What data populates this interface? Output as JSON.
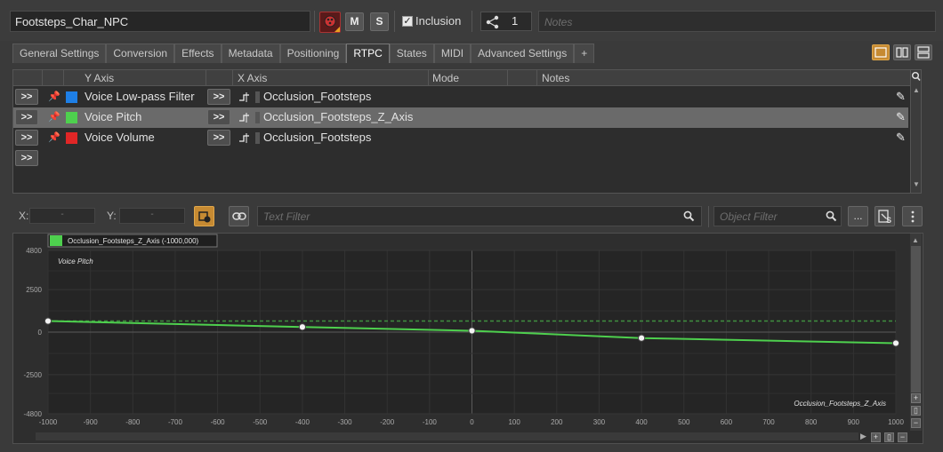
{
  "header": {
    "object_name": "Footsteps_Char_NPC",
    "mute_label": "M",
    "solo_label": "S",
    "inclusion_checked": true,
    "inclusion_label": "Inclusion",
    "references_count": "1",
    "notes_placeholder": "Notes"
  },
  "tabs": [
    {
      "label": "General Settings",
      "active": false
    },
    {
      "label": "Conversion",
      "active": false
    },
    {
      "label": "Effects",
      "active": false
    },
    {
      "label": "Metadata",
      "active": false
    },
    {
      "label": "Positioning",
      "active": false
    },
    {
      "label": "RTPC",
      "active": true
    },
    {
      "label": "States",
      "active": false
    },
    {
      "label": "MIDI",
      "active": false
    },
    {
      "label": "Advanced Settings",
      "active": false
    },
    {
      "label": "+",
      "active": false
    }
  ],
  "rtpc_table": {
    "columns": {
      "y_axis": "Y Axis",
      "x_axis": "X Axis",
      "mode": "Mode",
      "notes": "Notes"
    },
    "goto_label": ">>",
    "rows": [
      {
        "y_axis": "Voice Low-pass Filter",
        "color": "#1e7fe6",
        "x_axis": "Occlusion_Footsteps",
        "selected": false
      },
      {
        "y_axis": "Voice Pitch",
        "color": "#4ed04e",
        "x_axis": "Occlusion_Footsteps_Z_Axis",
        "selected": true
      },
      {
        "y_axis": "Voice Volume",
        "color": "#e02626",
        "x_axis": "Occlusion_Footsteps",
        "selected": false
      }
    ]
  },
  "filter_bar": {
    "x_label": "X:",
    "x_value": "-",
    "y_label": "Y:",
    "y_value": "-",
    "text_filter_placeholder": "Text Filter",
    "object_filter_placeholder": "Object Filter",
    "more_label": "..."
  },
  "chart_data": {
    "type": "line",
    "legend": "Occlusion_Footsteps_Z_Axis (-1000,000)",
    "ylabel": "Voice Pitch",
    "xlabel": "Occlusion_Footsteps_Z_Axis",
    "xlim": [
      -1000,
      1000
    ],
    "ylim": [
      -4800,
      4800
    ],
    "x_ticks": [
      -1000,
      -900,
      -800,
      -700,
      -600,
      -500,
      -400,
      -300,
      -200,
      -100,
      0,
      100,
      200,
      300,
      400,
      500,
      600,
      700,
      800,
      900,
      1000
    ],
    "y_ticks": [
      4800,
      2500,
      0,
      -2500,
      -4800
    ],
    "reference_line_y": 650,
    "series": [
      {
        "color": "#4ed04e",
        "x": [
          -1000,
          -400,
          0,
          400,
          1000
        ],
        "y": [
          650,
          300,
          80,
          -350,
          -650
        ]
      }
    ]
  }
}
